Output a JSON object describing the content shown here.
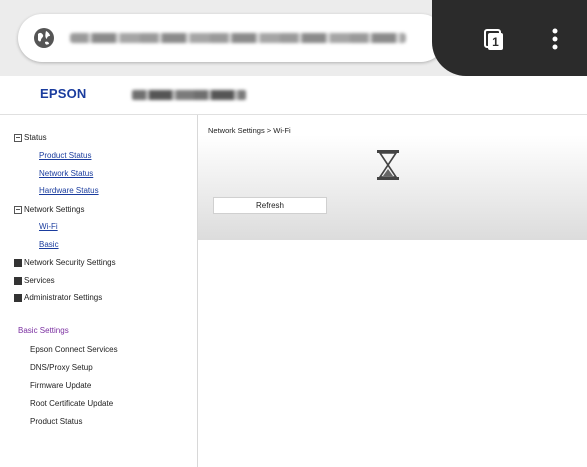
{
  "browser": {
    "icons": {
      "site": "globe-icon",
      "tabs": "tabs-icon",
      "menu": "more-vert-icon"
    },
    "tab_count": "1"
  },
  "header": {
    "logo": "EPSON"
  },
  "sidebar": {
    "status": {
      "label": "Status",
      "links": [
        "Product Status",
        "Network Status",
        "Hardware Status"
      ]
    },
    "network_settings": {
      "label": "Network Settings",
      "links": [
        "Wi-Fi",
        "Basic"
      ]
    },
    "collapsed": [
      "Network Security Settings",
      "Services",
      "Administrator Settings"
    ],
    "basic_settings": {
      "title": "Basic Settings",
      "items": [
        "Epson Connect Services",
        "DNS/Proxy Setup",
        "Firmware Update",
        "Root Certificate Update",
        "Product Status"
      ]
    }
  },
  "main": {
    "breadcrumb": "Network Settings > Wi-Fi",
    "refresh_label": "Refresh",
    "loading_icon": "hourglass-icon"
  },
  "colors": {
    "link": "#1a3c9e",
    "section": "#7a2ea0",
    "browser_dark": "#2b2b2b"
  }
}
